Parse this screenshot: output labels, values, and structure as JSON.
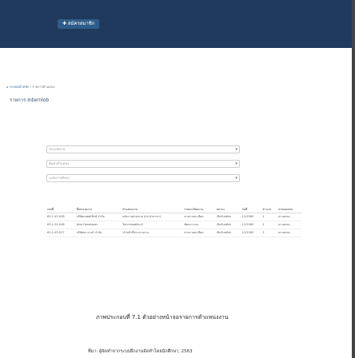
{
  "nav": {
    "tab_label": "✚ สมัครสมาชิก"
  },
  "breadcrumb": {
    "home": "⌂ ระบบหน้าหลัก",
    "path": " / รายการตำแหน่ง"
  },
  "page": {
    "title": "รายการ Internlob"
  },
  "filters": [
    {
      "placeholder": "ประเภทงาน",
      "value": ""
    },
    {
      "placeholder": "ค้นหาตำแหน่ง",
      "value": ""
    },
    {
      "placeholder": "ระดับการศึกษา",
      "value": ""
    }
  ],
  "table": {
    "headers": [
      "เลขที่",
      "ชื่อหน่วยงาน",
      "ตำแหน่งงาน",
      "รายละเอียดงาน",
      "สถานะ",
      "วันที่",
      "จำนวน",
      "ค่าตอบแทน"
    ],
    "rows": [
      [
        "63-1-43-028",
        "บริษัทแพทย์เท็กซ์ จำกัด",
        "พนักงานฝ่ายขาย (ประจำสาขา)",
        "ตามรายละเอียด",
        "เปิดรับสมัคร",
        "12/2563",
        "1",
        "ตามตกลง"
      ],
      [
        "63-1-32-048",
        "Java Developer",
        "วิศวกรซอฟต์แวร์",
        "พัฒนาระบบ",
        "เปิดรับสมัคร",
        "12/2563",
        "2",
        "ตามตกลง"
      ],
      [
        "63-1-43-027",
        "บริษัทพาวเวอร์ จำกัด",
        "เจ้าหน้าที่ประสานงาน",
        "ตามรายละเอียด",
        "เปิดรับสมัคร",
        "12/2563",
        "3",
        "ตามตกลง"
      ]
    ]
  },
  "caption": "ภาพประกอบที่ 7.1 ตัวอย่างหน้าจอรายการตำแหน่งงาน",
  "source": "ที่มา: ผู้จัดทำจากระบบฝึกงานจัดทำโดยนักศึกษา, 2563"
}
